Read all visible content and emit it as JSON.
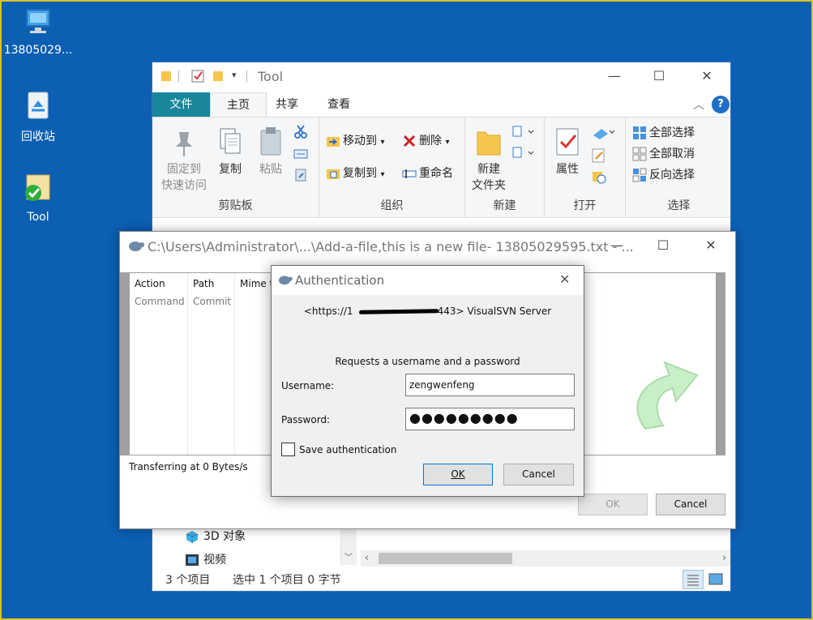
{
  "desktop": {
    "icons": [
      {
        "label": "13805029..."
      },
      {
        "label": "回收站"
      },
      {
        "label": "Tool"
      }
    ]
  },
  "explorer": {
    "title": "Tool",
    "title_separator": "|",
    "tabs": {
      "file": "文件",
      "home": "主页",
      "share": "共享",
      "view": "查看"
    },
    "ribbon": {
      "clipboard": {
        "label": "剪贴板",
        "pin": {
          "line1": "固定到",
          "line2": "快速访问"
        },
        "copy": "复制",
        "paste": "粘贴"
      },
      "organize": {
        "label": "组织",
        "move_to": "移动到",
        "copy_to": "复制到",
        "delete": "删除",
        "rename": "重命名"
      },
      "new": {
        "label": "新建",
        "new_folder": {
          "line1": "新建",
          "line2": "文件夹"
        }
      },
      "open": {
        "label": "打开",
        "properties": "属性"
      },
      "select": {
        "label": "选择",
        "select_all": "全部选择",
        "select_none": "全部取消",
        "invert": "反向选择"
      }
    },
    "tree": [
      {
        "label": "3D 对象"
      },
      {
        "label": "视频"
      }
    ],
    "status": {
      "item_count": "3 个项目",
      "selected": "选中 1 个项目  0 字节"
    }
  },
  "svn": {
    "title": "C:\\Users\\Administrator\\...\\Add-a-file,this is a new file- 13805029595.txt - ...",
    "columns": [
      {
        "header": "Action",
        "value": "Command"
      },
      {
        "header": "Path",
        "value": "Commit"
      },
      {
        "header": "Mime t",
        "value": ""
      }
    ],
    "transfer": "Transferring at 0 Bytes/s",
    "ok": "OK",
    "cancel": "Cancel"
  },
  "auth": {
    "title": "Authentication",
    "url_prefix": "<https://1",
    "url_suffix": "443> VisualSVN Server",
    "request": "Requests a username and a password",
    "username_label": "Username:",
    "username_value": "zengwenfeng",
    "password_label": "Password:",
    "password_value": "●●●●●●●●●",
    "save_label": "Save authentication",
    "ok": "OK",
    "cancel": "Cancel"
  }
}
